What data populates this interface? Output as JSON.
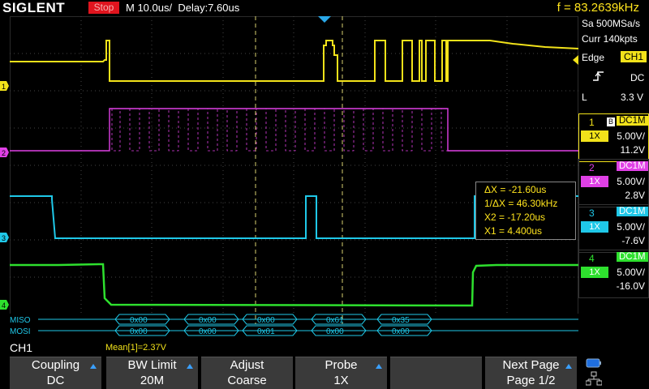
{
  "header": {
    "brand": "SIGLENT",
    "run_state": "Stop",
    "timebase": "M 10.0us/",
    "delay": "Delay:7.60us",
    "frequency": "f = 83.2639kHz"
  },
  "acquisition": {
    "sample_rate": "Sa 500MSa/s",
    "memory": "Curr 140kpts"
  },
  "trigger": {
    "type": "Edge",
    "source": "CH1",
    "slope_icon": "rising-edge-icon",
    "coupling": "DC",
    "mode": "L",
    "level": "3.3 V"
  },
  "channels": [
    {
      "num": "1",
      "coupling": "DC1M",
      "probe": "1X",
      "vdiv": "5.00V/",
      "offset": "11.2V",
      "color": "#f2e21a",
      "has_b": "B"
    },
    {
      "num": "2",
      "coupling": "DC1M",
      "probe": "1X",
      "vdiv": "5.00V/",
      "offset": "2.8V",
      "color": "#e040e6"
    },
    {
      "num": "3",
      "coupling": "DC1M",
      "probe": "1X",
      "vdiv": "5.00V/",
      "offset": "-7.6V",
      "color": "#1fc8e8"
    },
    {
      "num": "4",
      "coupling": "DC1M",
      "probe": "1X",
      "vdiv": "5.00V/",
      "offset": "-16.0V",
      "color": "#2ee02e"
    }
  ],
  "cursors": {
    "delta_x": "ΔX = -21.60us",
    "inv_delta_x": "1/ΔX = 46.30kHz",
    "x2": "X2 = -17.20us",
    "x1": "X1 = 4.400us"
  },
  "decode": {
    "miso_label": "MISO",
    "mosi_label": "MOSI",
    "miso_values": [
      "0x00",
      "0x00",
      "0x00",
      "0x61",
      "0x35"
    ],
    "mosi_values": [
      "0x00",
      "0x00",
      "0x01",
      "0x00",
      "0x00"
    ]
  },
  "status": {
    "channel": "CH1",
    "measurement": "Mean[1]=2.37V"
  },
  "softkeys": [
    {
      "line1": "Coupling",
      "line2": "DC"
    },
    {
      "line1": "BW Limit",
      "line2": "20M"
    },
    {
      "line1": "Adjust",
      "line2": "Coarse"
    },
    {
      "line1": "Probe",
      "line2": "1X"
    },
    {
      "line1": "Next Page",
      "line2": "Page 1/2"
    }
  ],
  "colors": {
    "ch1": "#f2e21a",
    "ch2": "#e040e6",
    "ch3": "#1fc8e8",
    "ch4": "#2ee02e",
    "stop": "#e0141e",
    "softkey_bg": "#3a3a3a"
  }
}
